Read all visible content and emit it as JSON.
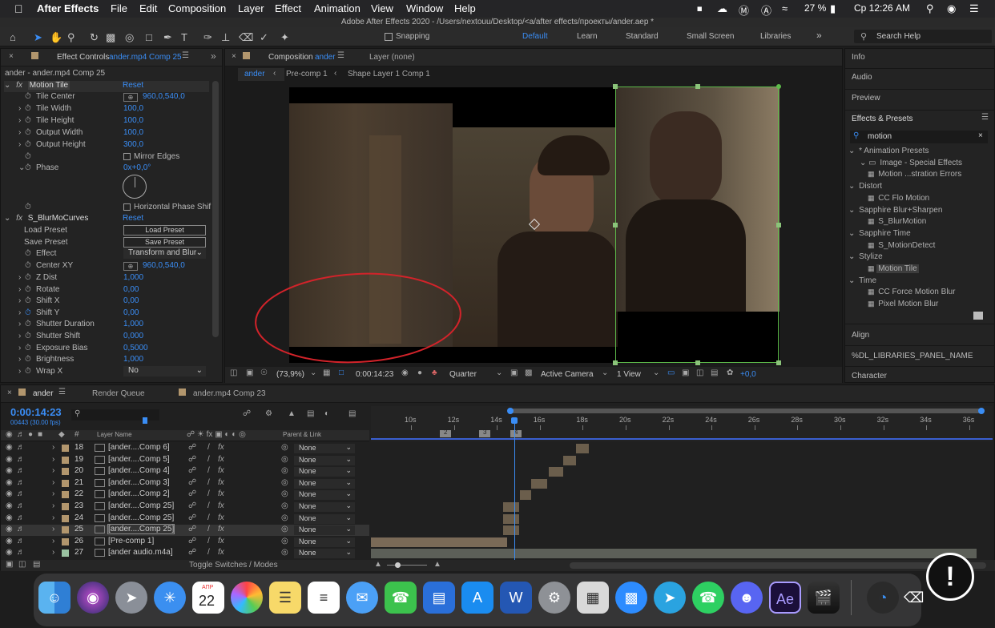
{
  "menubar": {
    "app": "After Effects",
    "items": [
      "File",
      "Edit",
      "Composition",
      "Layer",
      "Effect",
      "Animation",
      "View",
      "Window",
      "Help"
    ],
    "battery": "27 %",
    "clock": "Ср 12:26 AM"
  },
  "window_title": "Adobe After Effects 2020 - /Users/nextouu/Desktop/<a/after effects/проекты/ander.aep *",
  "toolbar": {
    "snapping": "Snapping",
    "workspaces": [
      "Default",
      "Learn",
      "Standard",
      "Small Screen",
      "Libraries"
    ],
    "search": "Search Help"
  },
  "effect_controls": {
    "tab": "Effect Controls",
    "tab_target": "ander.mp4 Comp 25",
    "layer_path": "ander - ander.mp4 Comp 25",
    "motion_tile": {
      "name": "Motion Tile",
      "reset": "Reset",
      "props": [
        {
          "label": "Tile Center",
          "value": "960,0,540,0"
        },
        {
          "label": "Tile Width",
          "value": "100,0"
        },
        {
          "label": "Tile Height",
          "value": "100,0"
        },
        {
          "label": "Output Width",
          "value": "100,0"
        },
        {
          "label": "Output Height",
          "value": "300,0"
        }
      ],
      "mirror_edges": "Mirror Edges",
      "phase_label": "Phase",
      "phase_value": "0x+0,0°",
      "hphase": "Horizontal Phase Shif"
    },
    "blur": {
      "name": "S_BlurMoCurves",
      "reset": "Reset",
      "load_preset_label": "Load Preset",
      "load_preset_btn": "Load Preset",
      "save_preset_label": "Save Preset",
      "save_preset_btn": "Save Preset",
      "effect_label": "Effect",
      "effect_value": "Transform and Blur",
      "center_label": "Center XY",
      "center_value": "960,0,540,0",
      "props": [
        {
          "label": "Z Dist",
          "value": "1,000"
        },
        {
          "label": "Rotate",
          "value": "0,00"
        },
        {
          "label": "Shift X",
          "value": "0,00"
        },
        {
          "label": "Shift Y",
          "value": "0,00"
        },
        {
          "label": "Shutter Duration",
          "value": "1,000"
        },
        {
          "label": "Shutter Shift",
          "value": "0,000"
        },
        {
          "label": "Exposure Bias",
          "value": "0,5000"
        },
        {
          "label": "Brightness",
          "value": "1,000"
        }
      ],
      "wrap_label": "Wrap X",
      "wrap_value": "No"
    }
  },
  "composition": {
    "tab": "Composition",
    "tab_target": "ander",
    "layer_tab": "Layer (none)",
    "breadcrumbs": [
      "ander",
      "Pre-comp 1",
      "Shape Layer 1 Comp 1"
    ],
    "zoom": "(73,9%)",
    "timecode": "0:00:14:23",
    "resolution": "Quarter",
    "camera": "Active Camera",
    "views": "1 View",
    "exposure": "+0,0"
  },
  "right_panel": {
    "info": "Info",
    "audio": "Audio",
    "preview": "Preview",
    "effects_presets": "Effects & Presets",
    "search": "motion",
    "tree": [
      {
        "text": "* Animation Presets",
        "level": 0
      },
      {
        "text": "Image - Special Effects",
        "level": 1
      },
      {
        "text": "Motion ...stration Errors",
        "level": 2
      },
      {
        "text": "Distort",
        "level": 0
      },
      {
        "text": "CC Flo Motion",
        "level": 2
      },
      {
        "text": "Sapphire Blur+Sharpen",
        "level": 0
      },
      {
        "text": "S_BlurMotion",
        "level": 2
      },
      {
        "text": "Sapphire Time",
        "level": 0
      },
      {
        "text": "S_MotionDetect",
        "level": 2
      },
      {
        "text": "Stylize",
        "level": 0
      },
      {
        "text": "Motion Tile",
        "level": 2
      },
      {
        "text": "Time",
        "level": 0
      },
      {
        "text": "CC Force Motion Blur",
        "level": 2
      },
      {
        "text": "Pixel Motion Blur",
        "level": 2
      }
    ],
    "align": "Align",
    "libraries": "%DL_LIBRARIES_PANEL_NAME",
    "character": "Character"
  },
  "timeline": {
    "tabs": [
      "ander",
      "Render Queue",
      "ander.mp4 Comp 23"
    ],
    "timecode": "0:00:14:23",
    "frames": "00443 (30.00 fps)",
    "col_layer": "Layer Name",
    "col_parent": "Parent & Link",
    "ruler": [
      "10s",
      "12s",
      "14s",
      "16s",
      "18s",
      "20s",
      "22s",
      "24s",
      "26s",
      "28s",
      "30s",
      "32s",
      "34s",
      "36s"
    ],
    "markers": [
      "2",
      "3",
      "4"
    ],
    "layers": [
      {
        "num": "18",
        "name": "[ander....Comp 6]",
        "parent": "None"
      },
      {
        "num": "19",
        "name": "[ander....Comp 5]",
        "parent": "None"
      },
      {
        "num": "20",
        "name": "[ander....Comp 4]",
        "parent": "None"
      },
      {
        "num": "21",
        "name": "[ander....Comp 3]",
        "parent": "None"
      },
      {
        "num": "22",
        "name": "[ander....Comp 2]",
        "parent": "None"
      },
      {
        "num": "23",
        "name": "[ander....Comp 25]",
        "parent": "None"
      },
      {
        "num": "24",
        "name": "[ander....Comp 25]",
        "parent": "None"
      },
      {
        "num": "25",
        "name": "[ander....Comp 25]",
        "parent": "None"
      },
      {
        "num": "26",
        "name": "[Pre-comp 1]",
        "parent": "None"
      },
      {
        "num": "27",
        "name": "[ander audio.m4a]",
        "parent": "None"
      }
    ],
    "toggle": "Toggle Switches / Modes"
  },
  "dock": {
    "calendar_month": "АПР",
    "calendar_day": "22",
    "ae": "Ae",
    "word": "W",
    "apps": [
      "Finder",
      "Siri",
      "Launchpad",
      "Safari",
      "Calendar",
      "Photos",
      "Notes",
      "Reminders",
      "Messages",
      "FaceTime",
      "Keynote",
      "App Store",
      "Word",
      "System Preferences",
      "Calculator",
      "Zoom",
      "Telegram",
      "WhatsApp",
      "Discord",
      "After Effects",
      "Final Cut Pro",
      "QuickTime",
      "Trash"
    ]
  },
  "colors": {
    "accent": "#3a8df5",
    "timecode": "#3a8df5",
    "selection_green": "#5dbb4a",
    "annotation_red": "#d2232a",
    "layer_label": "#b2966d"
  }
}
